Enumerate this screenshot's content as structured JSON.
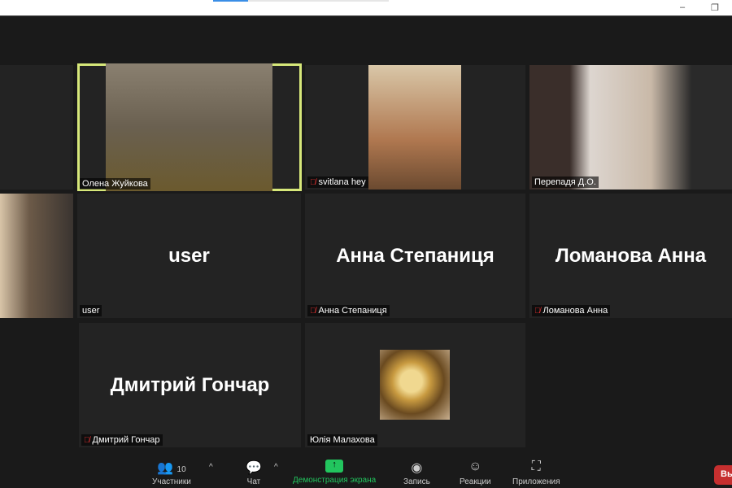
{
  "window": {
    "progress_percent": 20,
    "minimize": "–",
    "restore": "❐"
  },
  "tiles": [
    {
      "name": "Олена Жуйкова",
      "muted": false,
      "video": true,
      "active": true
    },
    {
      "name": "svitlana hey",
      "muted": true,
      "video": true
    },
    {
      "name": "Перепадя Д.О.",
      "muted": false,
      "video": true
    },
    {
      "name": "user",
      "muted": false,
      "video": false,
      "display": "user"
    },
    {
      "name": "Анна Степаниця",
      "muted": true,
      "video": false,
      "display": "Анна Степаниця"
    },
    {
      "name": "Ломанова Анна",
      "muted": true,
      "video": false,
      "display": "Ломанова Анна"
    },
    {
      "name": "Дмитрий Гончар",
      "muted": true,
      "video": false,
      "display": "Дмитрий Гончар"
    },
    {
      "name": "Юлія Малахова",
      "muted": false,
      "video": false,
      "avatar": "coffee-cup"
    }
  ],
  "toolbar": {
    "participants_label": "Участники",
    "participants_count": "10",
    "chat_label": "Чат",
    "share_label": "Демонстрация экрана",
    "record_label": "Запись",
    "reactions_label": "Реакции",
    "apps_label": "Приложения",
    "leave_label": "Вы",
    "share_color": "#22c55e",
    "leave_color": "#c62f2f"
  }
}
